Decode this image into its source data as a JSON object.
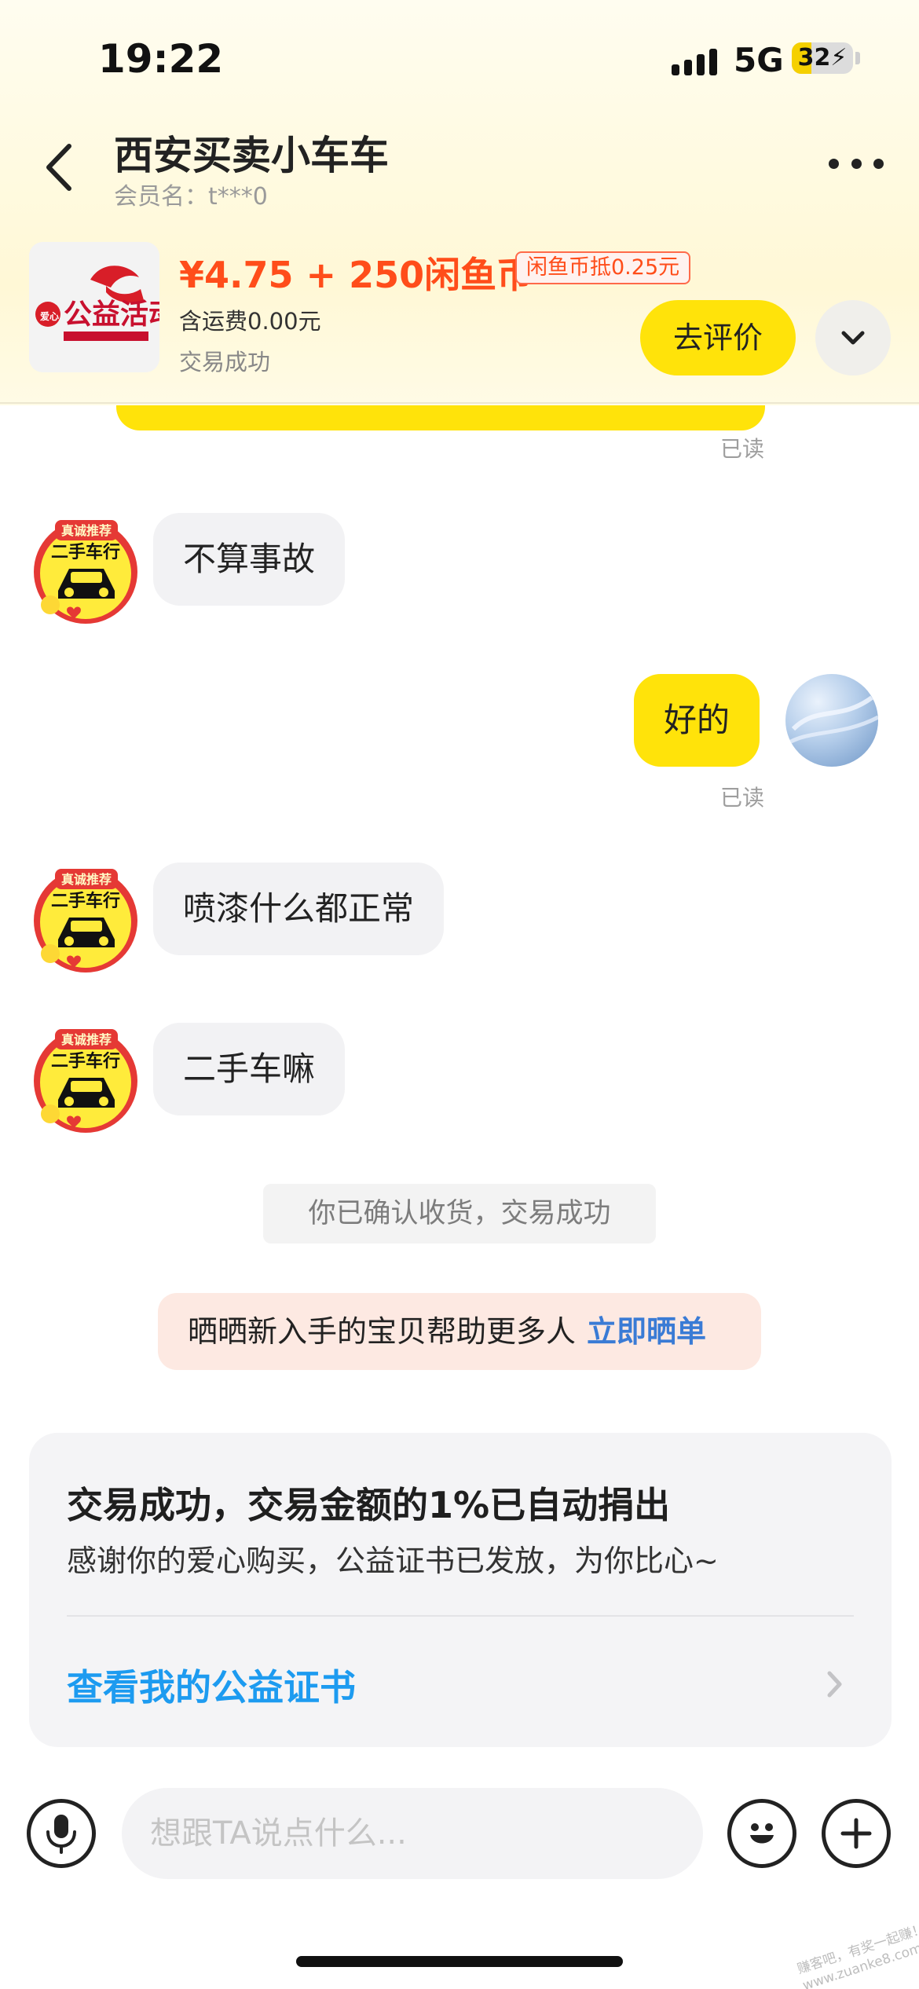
{
  "status_bar": {
    "time": "19:22",
    "network": "5G",
    "battery": "32",
    "battery_level_percent": 32
  },
  "nav": {
    "title": "西安买卖小车车",
    "subtitle": "会员名：t***0"
  },
  "product": {
    "thumb_text": "公益活动",
    "thumb_side_text": "爱心",
    "price": "¥4.75 + 250闲鱼币",
    "coin_tag": "闲鱼币抵0.25元",
    "shipping": "含运费0.00元",
    "status": "交易成功",
    "review_button": "去评价"
  },
  "chat": {
    "read_label": "已读",
    "shop_avatar_badge": "二手车行",
    "shop_avatar_ribbon": "真诚推荐",
    "messages": [
      {
        "sender": "seller",
        "text": "不算事故"
      },
      {
        "sender": "me",
        "text": "好的"
      },
      {
        "sender": "seller",
        "text": "喷漆什么都正常"
      },
      {
        "sender": "seller",
        "text": "二手车嘛"
      }
    ],
    "system_notice": "你已确认收货，交易成功",
    "share_prompt": "晒晒新入手的宝贝帮助更多人",
    "share_link": "立即晒单"
  },
  "charity": {
    "title": "交易成功，交易金额的1%已自动捐出",
    "desc": "感谢你的爱心购买，公益证书已发放，为你比心~",
    "link": "查看我的公益证书"
  },
  "input": {
    "placeholder": "想跟TA说点什么..."
  },
  "watermark": "赚客吧，有奖一起赚！\nwww.zuanke8.com",
  "colors": {
    "accent_yellow": "#ffe30a",
    "price_orange": "#ff4d1a",
    "link_blue": "#1d9bf0",
    "share_blue": "#3a7bd5"
  }
}
